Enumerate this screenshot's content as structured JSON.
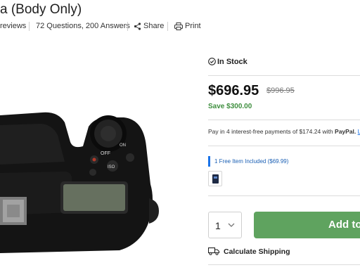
{
  "product": {
    "title": "a (Body Only)",
    "reviews_label": "reviews",
    "questions_label": "72 Questions, 200 Answers",
    "share_label": "Share",
    "print_label": "Print"
  },
  "camera_labels": {
    "off": "OFF",
    "on": "ON",
    "iso": "ISO"
  },
  "buy_box": {
    "stock_status": "In Stock",
    "price": "$696.95",
    "old_price": "$996.95",
    "savings": "Save $300.00",
    "paypal_text": "Pay in 4 interest-free payments of $174.24 with",
    "paypal_brand": "PayPal.",
    "paypal_link": "Le",
    "free_item": "1 Free Item Included ($69.99)",
    "quantity": "1",
    "add_to_cart": "Add to",
    "shipping": "Calculate Shipping"
  },
  "colors": {
    "accent_green": "#5fa35f",
    "savings_green": "#3f8f3f",
    "link_blue": "#1a73e8"
  },
  "icons": [
    "check-circle-icon",
    "share-icon",
    "print-icon",
    "chevron-down-icon",
    "truck-icon"
  ]
}
